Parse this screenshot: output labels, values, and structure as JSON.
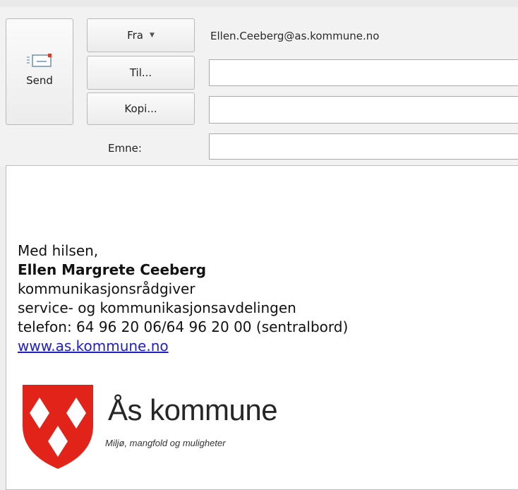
{
  "buttons": {
    "send": "Send",
    "from": "Fra",
    "to": "Til...",
    "cc": "Kopi..."
  },
  "from_address": "Ellen.Ceeberg@as.kommune.no",
  "subject_label": "Emne:",
  "fields": {
    "to": "",
    "cc": "",
    "subject": ""
  },
  "signature": {
    "greeting": "Med hilsen,",
    "name": "Ellen Margrete Ceeberg",
    "title": "kommunikasjonsrådgiver",
    "department": "service- og kommunikasjonsavdelingen",
    "phone": "telefon: 64 96 20 06/64 96 20 00 (sentralbord)",
    "website": "www.as.kommune.no"
  },
  "logo": {
    "name": "Ås kommune",
    "tagline": "Miljø, mangfold og muligheter",
    "color": "#e2231a"
  }
}
